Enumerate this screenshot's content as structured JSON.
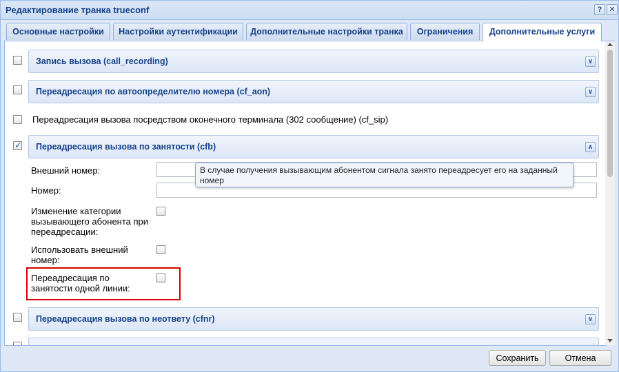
{
  "window": {
    "title": "Редактирование транка trueconf",
    "help": "?",
    "close": "✕"
  },
  "tabs": [
    {
      "label": "Основные настройки"
    },
    {
      "label": "Настройки аутентификации"
    },
    {
      "label": "Дополнительные настройки транка"
    },
    {
      "label": "Ограничения"
    },
    {
      "label": "Дополнительные услуги",
      "active": true
    }
  ],
  "sections": {
    "call_recording": {
      "title": "Запись вызова (call_recording)",
      "checked": false
    },
    "cf_aon": {
      "title": "Переадресация по автоопределителю номера (cf_aon)",
      "checked": false
    },
    "cf_sip": {
      "title": "Переадресация вызова посредством оконечного терминала (302 сообщение) (cf_sip)",
      "checked": false
    },
    "cfb": {
      "title": "Переадресация вызова по занятости (cfb)",
      "checked": true,
      "fields": {
        "external_number_label": "Внешний номер:",
        "number_label": "Номер:",
        "change_category_label_1": "Изменение категории",
        "change_category_label_2": "вызывающего абонента при",
        "change_category_label_3": "переадресации:",
        "use_external_label_1": "Использовать внешний",
        "use_external_label_2": "номер:",
        "single_line_label_1": "Переадресация по",
        "single_line_label_2": "занятости одной линии:"
      },
      "tooltip_line1": "В случае получения вызывающим абонентом сигнала занято переадресует его на заданный",
      "tooltip_line2": "номер"
    },
    "cfnr": {
      "title": "Переадресация вызова по неответу (cfnr)",
      "checked": false
    }
  },
  "buttons": {
    "save": "Сохранить",
    "cancel": "Отмена"
  },
  "icons": {
    "expand": "double-chevron-down-icon",
    "collapse": "double-chevron-up-icon"
  }
}
